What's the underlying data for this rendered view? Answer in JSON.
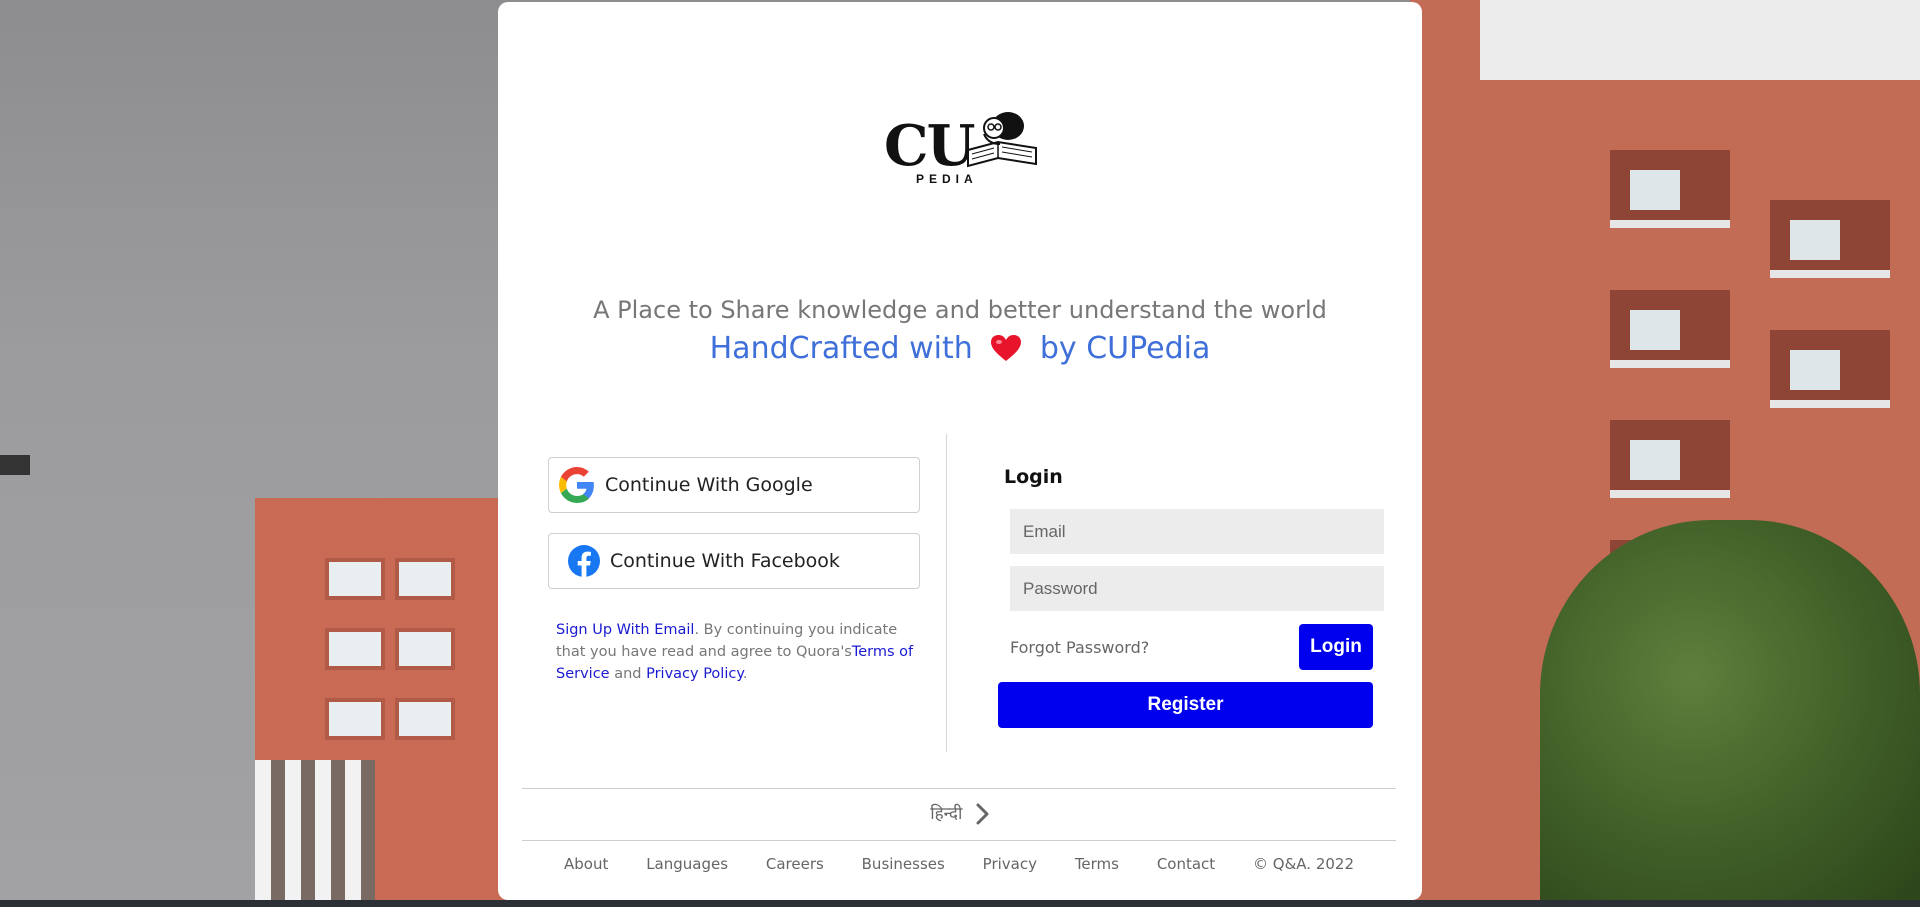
{
  "brand": {
    "logo_text": "CU",
    "logo_sub": "PEDIA"
  },
  "tagline": "A Place to Share knowledge and better understand the world",
  "handcrafted": {
    "prefix": "HandCrafted with",
    "suffix": "by CUPedia",
    "heart_icon": "heart-icon"
  },
  "social": {
    "google_label": "Continue With Google",
    "facebook_label": "Continue With Facebook"
  },
  "legal": {
    "signup_link": "Sign Up With Email",
    "text_1": ". By continuing you indicate that you have read and agree to Quora's",
    "terms_link": "Terms of Service",
    "text_2": " and ",
    "privacy_link": "Privacy Policy",
    "text_3": "."
  },
  "login": {
    "title": "Login",
    "email_placeholder": "Email",
    "password_placeholder": "Password",
    "forgot_label": "Forgot Password?",
    "login_label": "Login",
    "register_label": "Register"
  },
  "language": {
    "label": "हिन्दी"
  },
  "footer": {
    "links": [
      "About",
      "Languages",
      "Careers",
      "Businesses",
      "Privacy",
      "Terms",
      "Contact"
    ],
    "copyright": "© Q&A. 2022"
  },
  "colors": {
    "accent_blue": "#0000ee",
    "heading_blue": "#3f6fd8",
    "link_blue": "#1a1ad0"
  }
}
